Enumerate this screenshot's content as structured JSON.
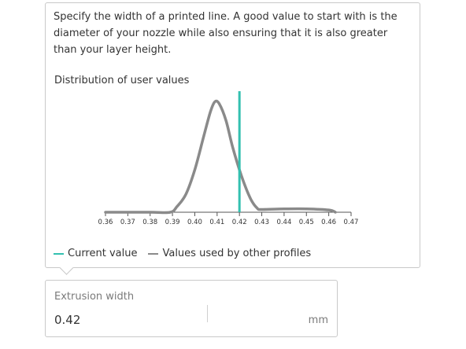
{
  "tooltip": {
    "description": "Specify the width of a printed line. A good value to start with is the diameter of your nozzle while also ensuring that it is also greater than your layer height.",
    "distribution_title": "Distribution of user values"
  },
  "chart_data": {
    "type": "line",
    "xlim": [
      0.36,
      0.47
    ],
    "ticks": [
      "0.36",
      "0.37",
      "0.38",
      "0.39",
      "0.40",
      "0.41",
      "0.42",
      "0.43",
      "0.44",
      "0.45",
      "0.46",
      "0.47"
    ],
    "series": [
      {
        "name": "Values used by other profiles",
        "x": [
          0.36,
          0.38,
          0.389,
          0.392,
          0.396,
          0.4,
          0.404,
          0.407,
          0.409,
          0.411,
          0.414,
          0.417,
          0.421,
          0.425,
          0.428,
          0.43,
          0.44,
          0.45,
          0.46,
          0.463
        ],
        "y": [
          0.0,
          0.0,
          0.0,
          0.05,
          0.16,
          0.38,
          0.68,
          0.9,
          0.99,
          0.97,
          0.82,
          0.58,
          0.32,
          0.12,
          0.035,
          0.025,
          0.03,
          0.03,
          0.02,
          0.0
        ],
        "color": "#8a8a8a"
      }
    ],
    "current_value": 0.42,
    "current_value_label": "Current value",
    "current_color": "#33c0b0"
  },
  "legend": {
    "current_label": "Current value",
    "others_label": "Values used by other profiles"
  },
  "field": {
    "label": "Extrusion width",
    "value": "0.42",
    "unit": "mm"
  }
}
